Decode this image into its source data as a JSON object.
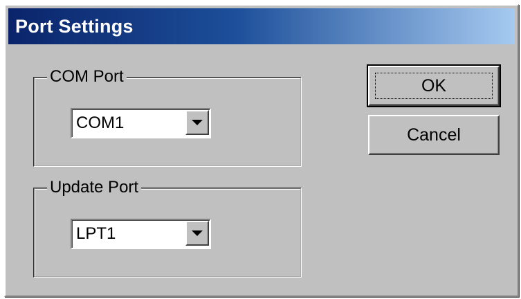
{
  "dialog": {
    "title": "Port Settings"
  },
  "com_port": {
    "label": "COM Port",
    "selected": "COM1"
  },
  "update_port": {
    "label": "Update Port",
    "selected": "LPT1"
  },
  "buttons": {
    "ok_label": "OK",
    "cancel_label": "Cancel"
  },
  "icons": {
    "dropdown": "chevron-down-icon"
  },
  "colors": {
    "title_gradient_start": "#0a246a",
    "title_gradient_end": "#a6caf0",
    "dialog_face": "#c0c0c0"
  }
}
